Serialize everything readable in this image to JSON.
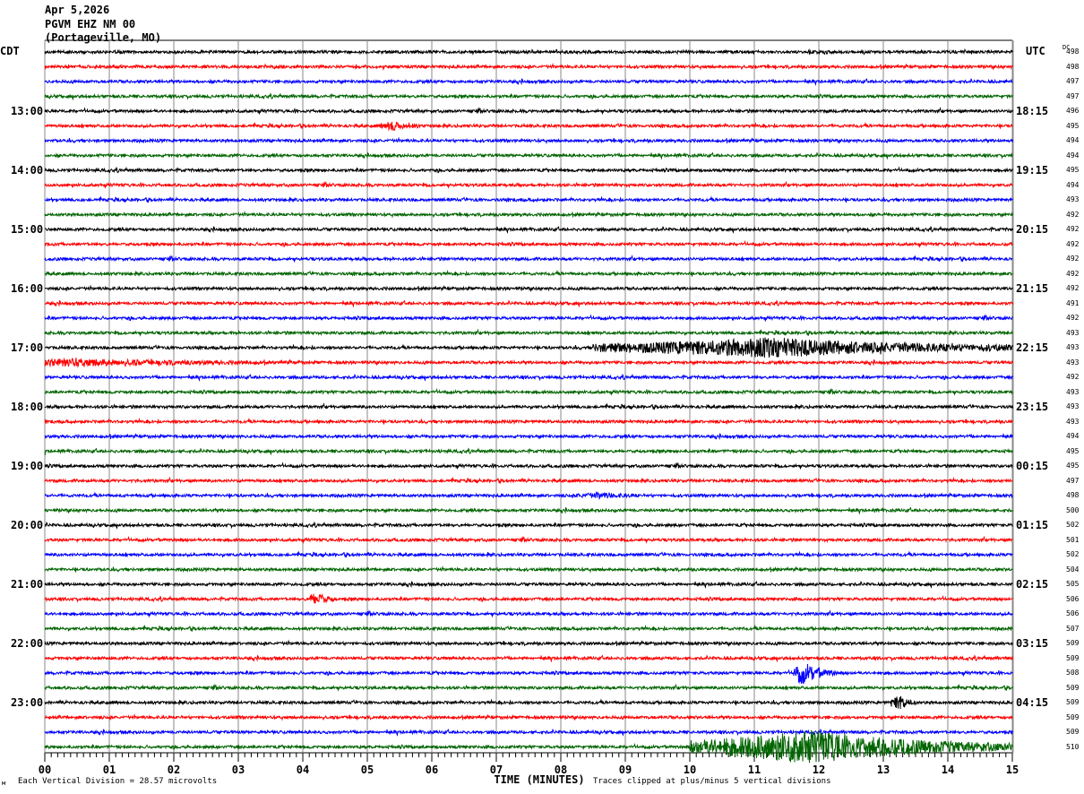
{
  "header": {
    "date": "Apr 5,2026",
    "station": "PGVM EHZ NM 00",
    "location": "(Portageville, MO)"
  },
  "left_zone": "CDT",
  "right_zone": "UTC",
  "dc_label": "DC",
  "footer": {
    "scale": "Each Vertical Division =   28.57 microvolts",
    "clip": "Traces clipped at plus/minus 5 vertical divisions",
    "small_mark": "м"
  },
  "chart_data": {
    "type": "line",
    "subtype": "helicorder",
    "xlabel": "TIME (MINUTES)",
    "xlim": [
      0,
      15
    ],
    "x_ticks": [
      "00",
      "01",
      "02",
      "03",
      "04",
      "05",
      "06",
      "07",
      "08",
      "09",
      "10",
      "11",
      "12",
      "13",
      "14",
      "15"
    ],
    "grid": true,
    "trace_colors": [
      "#000000",
      "#ff0000",
      "#0000ff",
      "#006400"
    ],
    "row_minutes": 15,
    "left_time_labels": [
      {
        "row": 4,
        "label": "13:00"
      },
      {
        "row": 8,
        "label": "14:00"
      },
      {
        "row": 12,
        "label": "15:00"
      },
      {
        "row": 16,
        "label": "16:00"
      },
      {
        "row": 20,
        "label": "17:00"
      },
      {
        "row": 24,
        "label": "18:00"
      },
      {
        "row": 28,
        "label": "19:00"
      },
      {
        "row": 32,
        "label": "20:00"
      },
      {
        "row": 36,
        "label": "21:00"
      },
      {
        "row": 40,
        "label": "22:00"
      },
      {
        "row": 44,
        "label": "23:00"
      }
    ],
    "right_time_labels": [
      {
        "row": 4,
        "label": "18:15"
      },
      {
        "row": 8,
        "label": "19:15"
      },
      {
        "row": 12,
        "label": "20:15"
      },
      {
        "row": 16,
        "label": "21:15"
      },
      {
        "row": 20,
        "label": "22:15"
      },
      {
        "row": 24,
        "label": "23:15"
      },
      {
        "row": 28,
        "label": "00:15"
      },
      {
        "row": 32,
        "label": "01:15"
      },
      {
        "row": 36,
        "label": "02:15"
      },
      {
        "row": 40,
        "label": "03:15"
      },
      {
        "row": 44,
        "label": "04:15"
      }
    ],
    "dc_values": [
      498,
      498,
      497,
      497,
      496,
      495,
      494,
      494,
      495,
      494,
      493,
      492,
      492,
      492,
      492,
      492,
      492,
      491,
      492,
      493,
      493,
      493,
      492,
      493,
      493,
      493,
      494,
      495,
      495,
      497,
      498,
      500,
      502,
      501,
      502,
      504,
      505,
      506,
      506,
      507,
      509,
      509,
      508,
      509,
      509,
      509,
      509,
      510
    ],
    "events": [
      {
        "row": 20,
        "start_min": 8.5,
        "end_min": 15,
        "peak_min": 11.2,
        "amplitude_div": 3.5
      },
      {
        "row": 21,
        "start_min": 0,
        "end_min": 4,
        "peak_min": 0.5,
        "amplitude_div": 1.2
      },
      {
        "row": 47,
        "start_min": 10,
        "end_min": 15,
        "peak_min": 11.8,
        "amplitude_div": 6
      },
      {
        "row": 42,
        "start_min": 11.6,
        "end_min": 12.3,
        "peak_min": 11.75,
        "amplitude_div": 4
      },
      {
        "row": 44,
        "start_min": 13.1,
        "end_min": 13.5,
        "peak_min": 13.25,
        "amplitude_div": 2.5
      },
      {
        "row": 37,
        "start_min": 4.1,
        "end_min": 4.5,
        "peak_min": 4.2,
        "amplitude_div": 2.5
      },
      {
        "row": 5,
        "start_min": 5.2,
        "end_min": 5.8,
        "peak_min": 5.4,
        "amplitude_div": 1.5
      },
      {
        "row": 30,
        "start_min": 8.2,
        "end_min": 9.2,
        "peak_min": 8.6,
        "amplitude_div": 0.8
      }
    ]
  }
}
